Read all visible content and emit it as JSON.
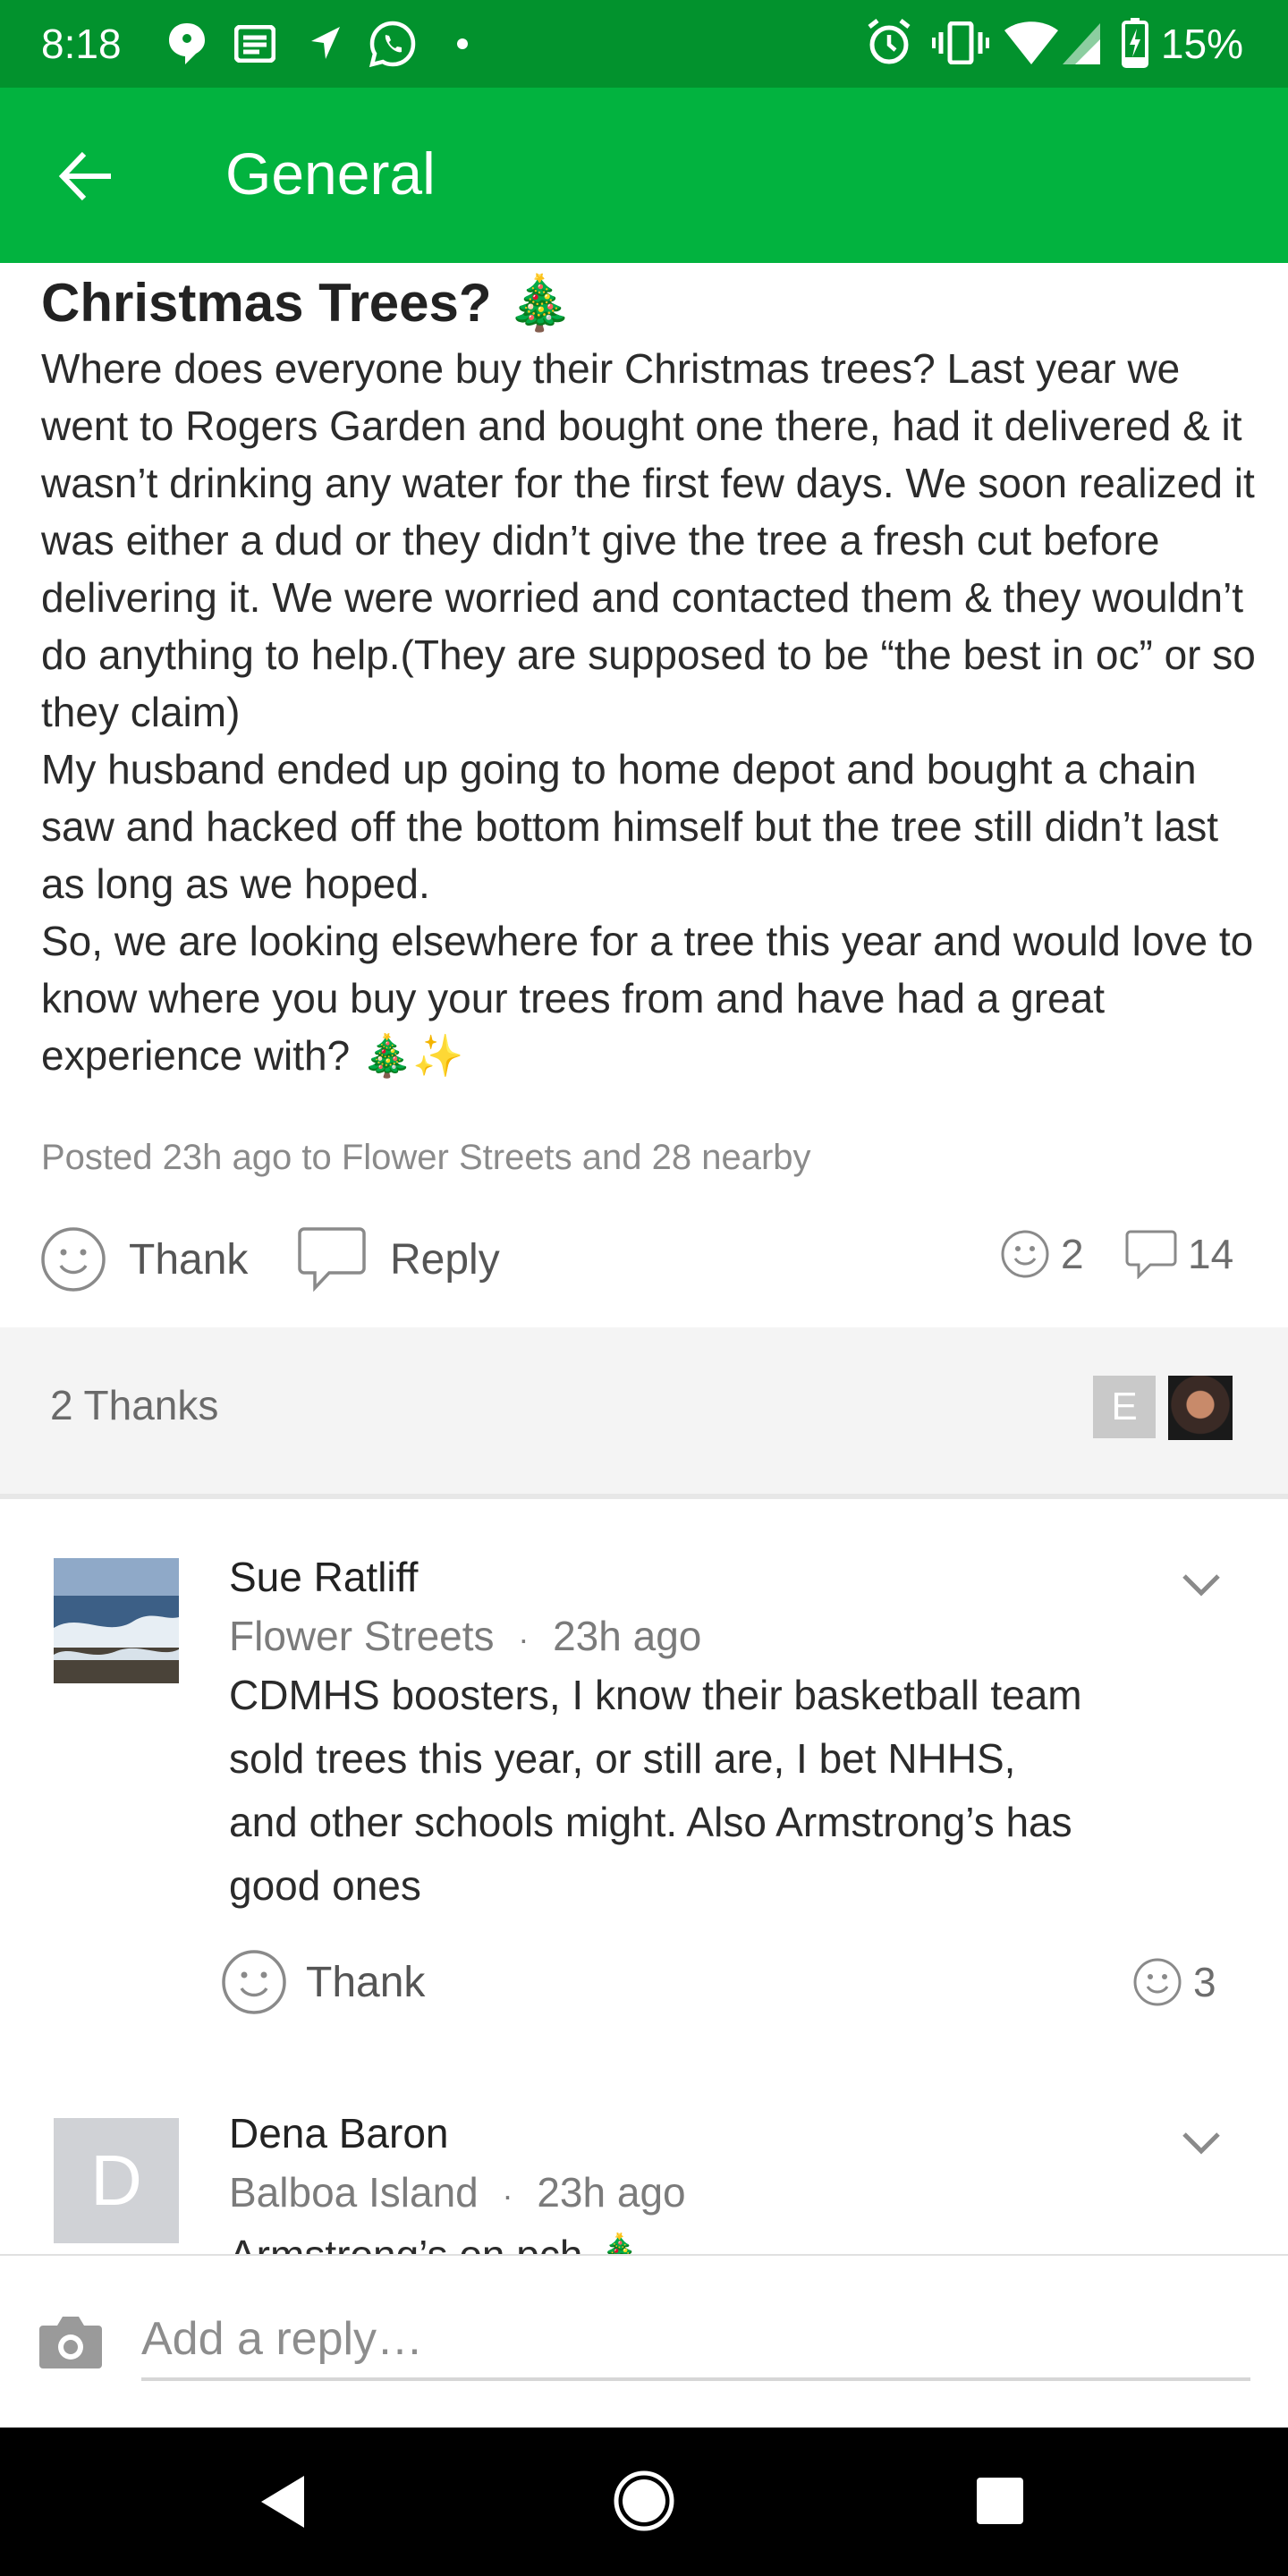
{
  "status_bar": {
    "time": "8:18",
    "battery": "15%",
    "icons": [
      "chat-bubble-icon",
      "news-icon",
      "navigation-icon",
      "whatsapp-icon",
      "dot-icon",
      "alarm-icon",
      "vibrate-icon",
      "wifi-icon",
      "signal-icon",
      "battery-icon"
    ]
  },
  "app_bar": {
    "title": "General"
  },
  "post": {
    "title": "Christmas Trees? 🎄",
    "body": "Where does everyone buy their Christmas trees? Last year we went to Rogers Garden and bought one there, had it delivered & it wasn’t drinking any water for the first few days. We soon realized it was either a dud or they didn’t give the tree a fresh cut before delivering it. We were worried and contacted them & they wouldn’t do anything to help.(They are supposed to be “the best in oc” or so they claim)\nMy husband ended up going to home depot and bought a chain saw and hacked off the bottom himself but the tree still didn’t last as long as we hoped.\nSo, we are looking elsewhere for a tree this year and would love to know where you buy your trees from and have had a great experience with? 🎄✨",
    "meta": "Posted 23h ago to Flower Streets and 28 nearby",
    "thank_label": "Thank",
    "reply_label": "Reply",
    "thanks_count": "2",
    "replies_count": "14"
  },
  "thanks_bar": {
    "label": "2 Thanks",
    "avatar_letter": "E"
  },
  "comments": [
    {
      "name": "Sue Ratliff",
      "neighborhood": "Flower Streets",
      "time": "23h ago",
      "text": "CDMHS boosters, I know their basketball team sold trees this year, or still are, I bet NHHS, and other schools might. Also Armstrong’s has good ones",
      "thank_label": "Thank",
      "thanks_count": "3"
    },
    {
      "name": "Dena Baron",
      "avatar_letter": "D",
      "neighborhood": "Balboa Island",
      "time": "23h ago",
      "text": "Armstrong’s on pch 🎄"
    }
  ],
  "separator": "·",
  "reply_bar": {
    "placeholder": "Add a reply…"
  },
  "colors": {
    "status_bar": "#02922d",
    "app_bar": "#02b33f",
    "nav_bar": "#000000"
  }
}
